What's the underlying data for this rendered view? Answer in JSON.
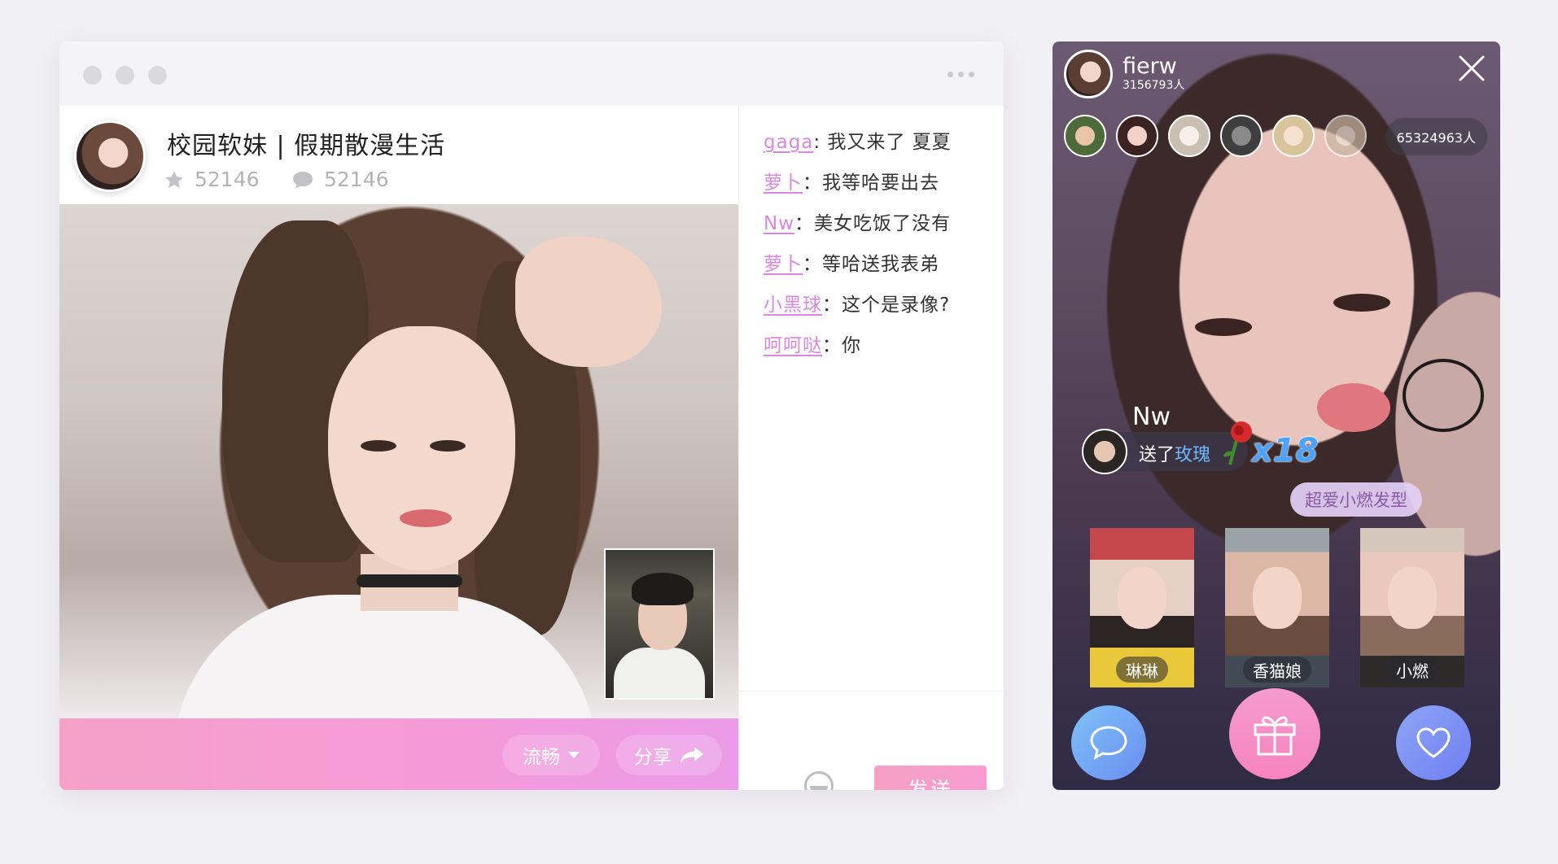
{
  "window": {
    "room_title": "校园软妹 | 假期散漫生活",
    "star_count": "52146",
    "comment_count": "52146",
    "quality_label": "流畅",
    "share_label": "分享",
    "send_label": "发送"
  },
  "chat": {
    "messages": [
      {
        "user": "gaga",
        "sep": ":",
        "text": " 我又来了 夏夏"
      },
      {
        "user": "萝卜",
        "sep": "：",
        "text": "我等哈要出去"
      },
      {
        "user": "Nw",
        "sep": "：",
        "text": "美女吃饭了没有"
      },
      {
        "user": "萝卜",
        "sep": "：",
        "text": "等哈送我表弟"
      },
      {
        "user": "小黑球",
        "sep": "：",
        "text": "这个是录像?"
      },
      {
        "user": "呵呵哒",
        "sep": "：",
        "text": "你"
      }
    ]
  },
  "phone": {
    "host_name": "fierw",
    "host_fans": "3156793人",
    "total_viewers": "65324963人",
    "gift": {
      "sender": "Nw",
      "prefix": "送了",
      "gift_name": "玫瑰",
      "combo": "x18"
    },
    "tag": "超爱小燃发型",
    "cards": [
      {
        "label": "琳琳"
      },
      {
        "label": "香猫娘"
      },
      {
        "label": "小燃"
      }
    ]
  },
  "colors": {
    "accent_pink": "#f59ad8",
    "chat_user": "#d987e0",
    "gift_blue": "#4aa3ff"
  }
}
